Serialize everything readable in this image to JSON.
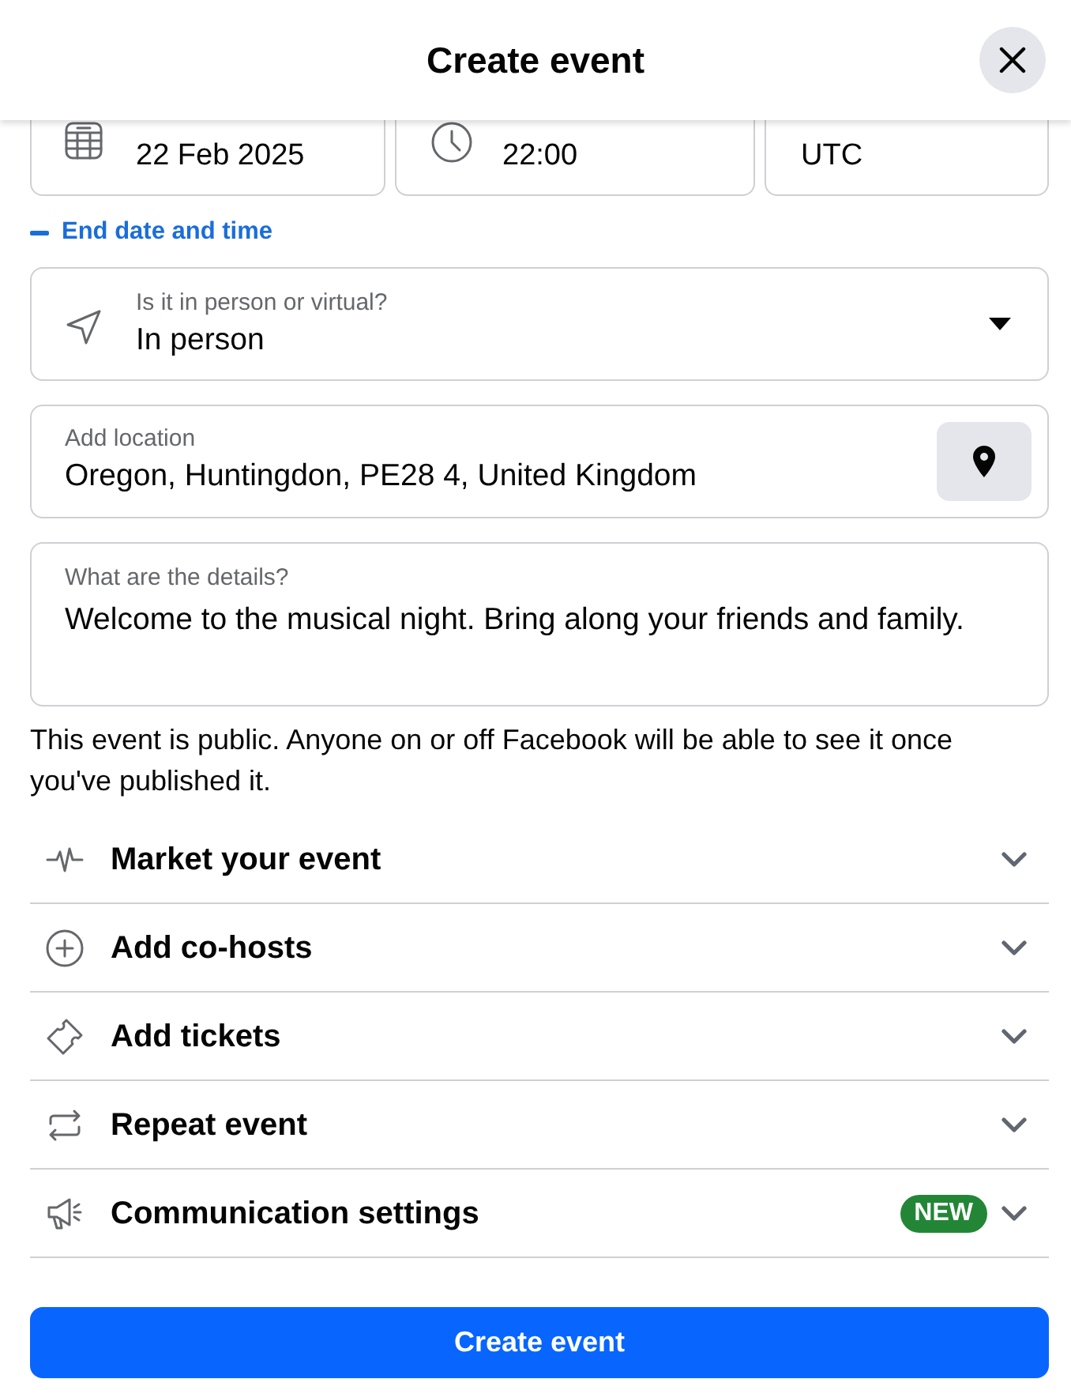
{
  "header": {
    "title": "Create event"
  },
  "end_fields": [
    {
      "kind": "date",
      "value": "22 Feb 2025"
    },
    {
      "kind": "time",
      "value": "22:00"
    },
    {
      "kind": "timezone",
      "value": "UTC"
    }
  ],
  "end_toggle": {
    "label": "End date and time",
    "expanded": true
  },
  "event_type": {
    "label": "Is it in person or virtual?",
    "value": "In person"
  },
  "location": {
    "label": "Add location",
    "value": "Oregon, Huntingdon, PE28 4, United Kingdom"
  },
  "details": {
    "label": "What are the details?",
    "value": "Welcome to the musical night. Bring along your friends and family."
  },
  "privacy_note": "This event is public. Anyone on or off Facebook will be able to see it once you've published it.",
  "sections": [
    {
      "kind": "market",
      "label": "Market your event"
    },
    {
      "kind": "cohosts",
      "label": "Add co-hosts"
    },
    {
      "kind": "tickets",
      "label": "Add tickets"
    },
    {
      "kind": "repeat",
      "label": "Repeat event"
    },
    {
      "kind": "communication",
      "label": "Communication settings",
      "badge": "NEW"
    }
  ],
  "submit": {
    "label": "Create event"
  }
}
